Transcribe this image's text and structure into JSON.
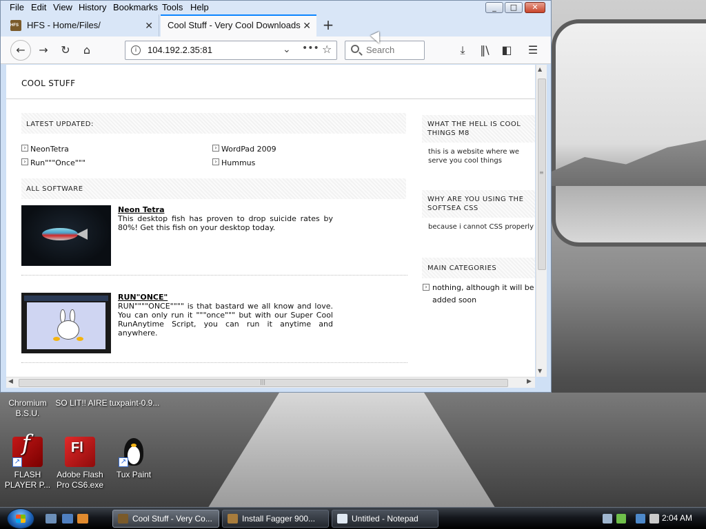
{
  "browser": {
    "menu": [
      "File",
      "Edit",
      "View",
      "History",
      "Bookmarks",
      "Tools",
      "Help"
    ],
    "window_controls": {
      "minimize": "_",
      "maximize": "□",
      "close": "✕"
    },
    "tabs": [
      {
        "label": "HFS - Home/Files/",
        "active": false
      },
      {
        "label": "Cool Stuff - Very Cool Downloads",
        "active": true
      }
    ],
    "new_tab": "+",
    "url": "104.192.2.35:81",
    "search_placeholder": "Search",
    "icons": [
      "back-icon",
      "forward-icon",
      "reload-icon",
      "home-icon",
      "download-icon",
      "library-icon",
      "sidebar-icon",
      "menu-icon"
    ]
  },
  "page": {
    "site_title": "COOL STUFF",
    "latest": {
      "heading": "LATEST UPDATED:",
      "items": [
        "NeonTetra",
        "WordPad 2009",
        "Run\"\"\"Once\"\"\"",
        "Hummus"
      ]
    },
    "all_software": {
      "heading": "ALL SOFTWARE",
      "entries": [
        {
          "name": "Neon Tetra",
          "description": "This desktop fish has proven to drop suicide rates by 80%! Get this fish on your desktop today."
        },
        {
          "name": "RUN\"ONCE\"",
          "description": "RUN\"\"\"\"ONCE\"\"\"\" is that bastard we all know and love. You can only run it \"\"\"once\"\"\" but with our Super Cool RunAnytime Script, you can run it anytime and anywhere."
        }
      ]
    },
    "sidebar": [
      {
        "heading": "WHAT THE HELL IS COOL THINGS M8",
        "text": "this is a website where we serve you cool things"
      },
      {
        "heading": "WHY ARE YOU USING THE SOFTSEA CSS",
        "text": "because i cannot CSS properly"
      },
      {
        "heading": "MAIN CATEGORIES",
        "items": [
          "nothing, although it will be added soon"
        ]
      }
    ]
  },
  "desktop_icons": [
    {
      "label": "Chromium B.S.U."
    },
    {
      "label": "SO LIT!! AIRE"
    },
    {
      "label": "tuxpaint-0.9..."
    },
    {
      "label": "FLASH PLAYER P...",
      "icon": "flash-player-icon"
    },
    {
      "label": "Adobe Flash Pro CS6.exe",
      "icon": "flash-pro-icon"
    },
    {
      "label": "Tux Paint",
      "icon": "tux-paint-icon"
    }
  ],
  "taskbar": {
    "buttons": [
      {
        "label": "Cool Stuff - Very Co...",
        "active": true
      },
      {
        "label": "Install Fagger 900...",
        "active": false
      },
      {
        "label": "Untitled - Notepad",
        "active": false
      }
    ],
    "clock": "2:04 AM"
  }
}
